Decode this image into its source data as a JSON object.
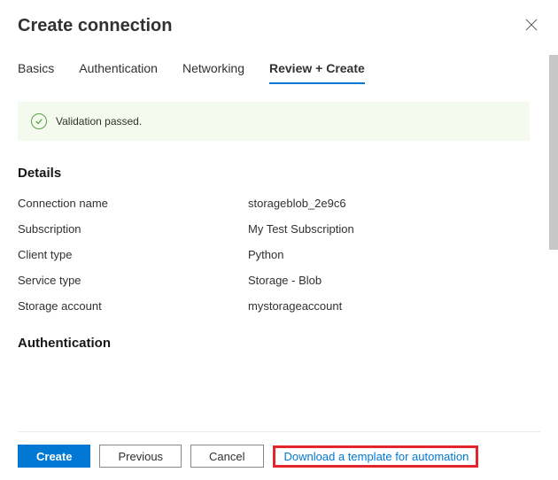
{
  "header": {
    "title": "Create connection"
  },
  "tabs": [
    {
      "label": "Basics"
    },
    {
      "label": "Authentication"
    },
    {
      "label": "Networking"
    },
    {
      "label": "Review + Create"
    }
  ],
  "validation": {
    "message": "Validation passed."
  },
  "sections": {
    "details": {
      "title": "Details",
      "rows": [
        {
          "label": "Connection name",
          "value": "storageblob_2e9c6"
        },
        {
          "label": "Subscription",
          "value": "My Test Subscription"
        },
        {
          "label": "Client type",
          "value": "Python"
        },
        {
          "label": "Service type",
          "value": "Storage - Blob"
        },
        {
          "label": "Storage account",
          "value": "mystorageaccount"
        }
      ]
    },
    "authentication": {
      "title": "Authentication"
    }
  },
  "footer": {
    "create": "Create",
    "previous": "Previous",
    "cancel": "Cancel",
    "download": "Download a template for automation"
  }
}
